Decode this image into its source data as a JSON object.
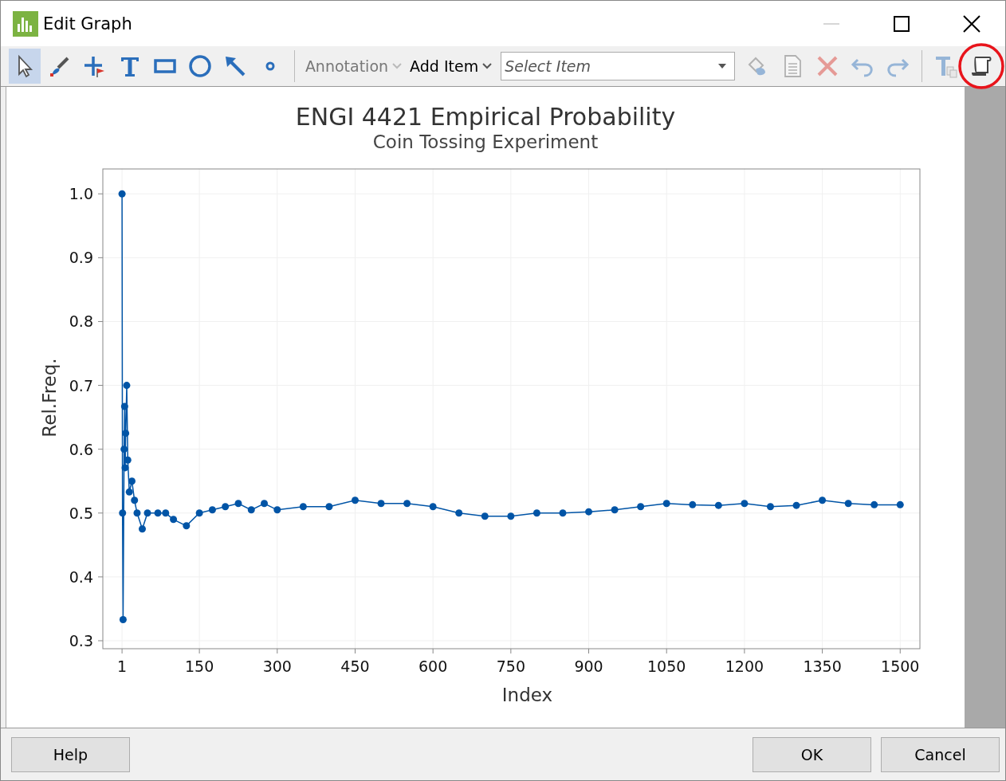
{
  "window": {
    "title": "Edit Graph",
    "minimize_disabled": true
  },
  "toolbar": {
    "tools": [
      {
        "kind": "pointer",
        "selected": true
      },
      {
        "kind": "brush",
        "selected": false
      },
      {
        "kind": "crosshair",
        "selected": false
      },
      {
        "kind": "text",
        "selected": false
      },
      {
        "kind": "rectangle",
        "selected": false
      },
      {
        "kind": "ellipse",
        "selected": false
      },
      {
        "kind": "arrow",
        "selected": false
      },
      {
        "kind": "marker",
        "selected": false
      }
    ],
    "menus": [
      {
        "label": "Annotation",
        "disabled": true
      },
      {
        "label": "Add Item",
        "disabled": false
      }
    ],
    "select": {
      "placeholder": "Select Item"
    },
    "actions": [
      {
        "kind": "fill",
        "disabled": true
      },
      {
        "kind": "document",
        "disabled": true
      },
      {
        "kind": "delete",
        "disabled": true
      },
      {
        "kind": "undo",
        "disabled": true
      },
      {
        "kind": "redo",
        "disabled": true
      },
      {
        "kind": "text-copy",
        "disabled": true
      },
      {
        "kind": "scroll",
        "disabled": false,
        "highlighted": true
      }
    ]
  },
  "graph": {
    "title": "ENGI 4421 Empirical Probability",
    "subtitle": "Coin Tossing Experiment",
    "chart_data": {
      "type": "line",
      "xlabel": "Index",
      "ylabel": "Rel.Freq.",
      "grid": true,
      "x": [
        1,
        2,
        3,
        5,
        6,
        7,
        8,
        10,
        12,
        15,
        20,
        25,
        30,
        40,
        50,
        70,
        85,
        100,
        125,
        150,
        175,
        200,
        225,
        250,
        275,
        300,
        350,
        400,
        450,
        500,
        550,
        600,
        650,
        700,
        750,
        800,
        850,
        900,
        950,
        1000,
        1050,
        1100,
        1150,
        1200,
        1250,
        1300,
        1350,
        1400,
        1450,
        1500
      ],
      "series": [
        {
          "color": "#0054a6",
          "marker": "circle",
          "values": [
            1.0,
            0.5,
            0.333,
            0.6,
            0.667,
            0.571,
            0.625,
            0.7,
            0.583,
            0.533,
            0.55,
            0.52,
            0.5,
            0.475,
            0.5,
            0.5,
            0.5,
            0.49,
            0.48,
            0.5,
            0.505,
            0.51,
            0.515,
            0.505,
            0.515,
            0.505,
            0.51,
            0.51,
            0.52,
            0.515,
            0.515,
            0.51,
            0.5,
            0.495,
            0.495,
            0.5,
            0.5,
            0.502,
            0.505,
            0.51,
            0.515,
            0.513,
            0.512,
            0.515,
            0.51,
            0.512,
            0.52,
            0.515,
            0.513,
            0.513
          ]
        }
      ],
      "xlim": [
        -36,
        1538
      ],
      "ylim": [
        0.2875,
        1.039
      ],
      "xticks": [
        1,
        150,
        300,
        450,
        600,
        750,
        900,
        1050,
        1200,
        1350,
        1500
      ],
      "yticks": [
        0.3,
        0.4,
        0.5,
        0.6,
        0.7,
        0.8,
        0.9,
        {
          "value": 1,
          "label": "1.0"
        }
      ]
    }
  },
  "buttons": [
    {
      "label": "Help",
      "kind": "left"
    },
    {
      "label": "OK",
      "kind": "right"
    },
    {
      "label": "Cancel",
      "kind": "right"
    }
  ]
}
